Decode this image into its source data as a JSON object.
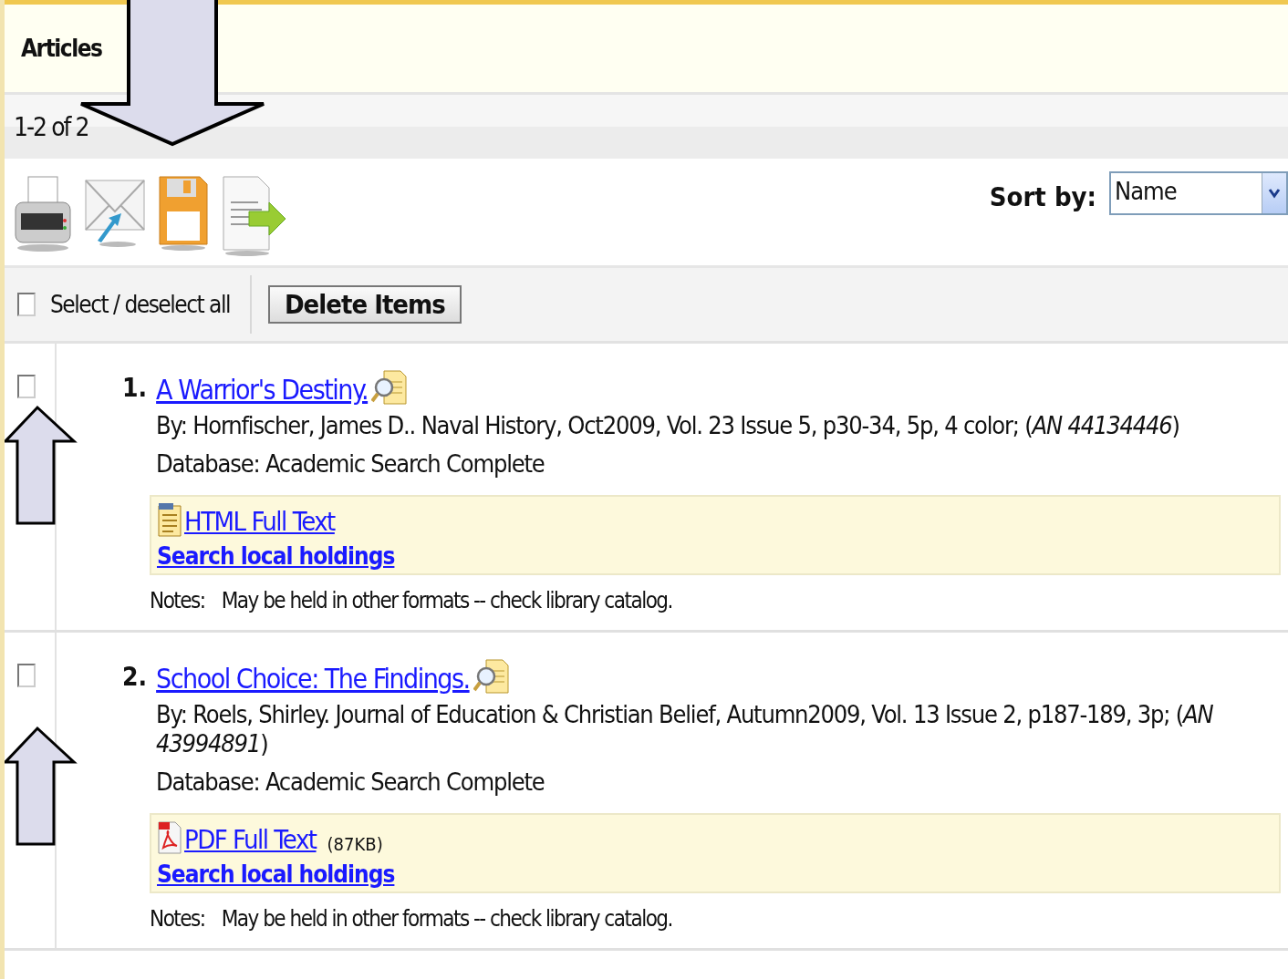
{
  "header": {
    "title": "Articles"
  },
  "pager": {
    "range": "1-2 of 2"
  },
  "toolbar": {
    "sort_label": "Sort by:",
    "sort_value": "Name"
  },
  "actions": {
    "select_all": {
      "label": "Select / deselect all",
      "checked": false
    },
    "delete_button": "Delete Items"
  },
  "results": [
    {
      "number": "1.",
      "title": "A Warrior's Destiny.",
      "checked": false,
      "citation": "By: Hornfischer, James D.. Naval History, Oct2009, Vol. 23 Issue 5, p30-34, 5p, 4 color; (*AN 44134446*)",
      "database": "Database: Academic Search Complete",
      "full_text": {
        "kind": "html",
        "label": "HTML Full Text"
      },
      "holdings_link": "Search local holdings",
      "notes_label": "Notes:",
      "notes": "May be held in other formats -- check library catalog."
    },
    {
      "number": "2.",
      "title": "School Choice: The Findings.",
      "checked": false,
      "citation": "By: Roels, Shirley. Journal of Education & Christian Belief, Autumn2009, Vol. 13 Issue 2, p187-189, 3p; (*AN 43994891*)",
      "database": "Database: Academic Search Complete",
      "full_text": {
        "kind": "pdf",
        "label": "PDF Full Text",
        "size": "(87KB)"
      },
      "holdings_link": "Search local holdings",
      "notes_label": "Notes:",
      "notes": "May be held in other formats -- check library catalog."
    }
  ]
}
